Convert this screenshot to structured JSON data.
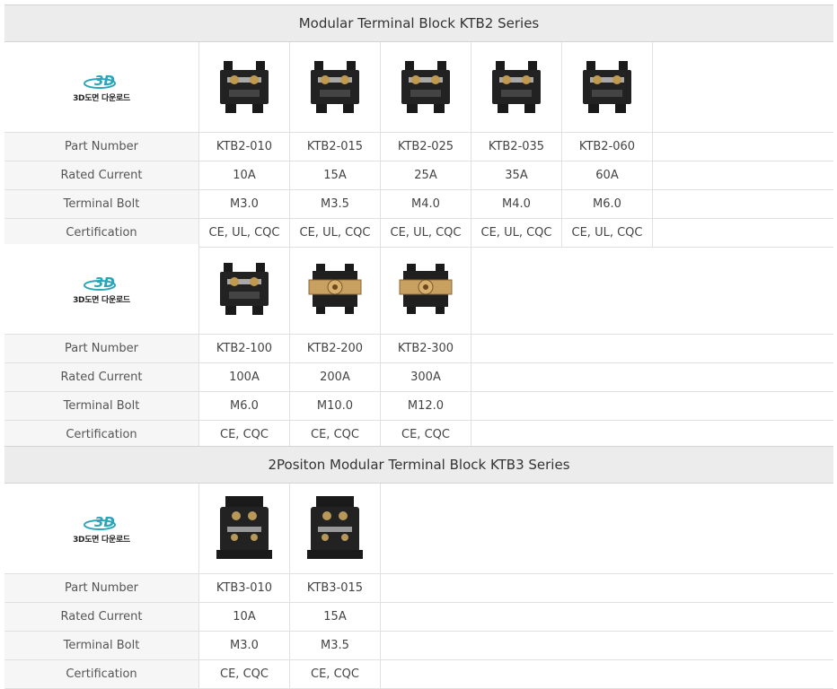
{
  "sections": [
    {
      "title": "Modular Terminal Block KTB2 Series",
      "groups": [
        {
          "logo_text": "3D도면 다운로드",
          "logo_mark": "3D",
          "products": [
            {
              "part": "KTB2-010",
              "current": "10A",
              "bolt": "M3.0",
              "cert": "CE, UL, CQC",
              "style": "dark"
            },
            {
              "part": "KTB2-015",
              "current": "15A",
              "bolt": "M3.5",
              "cert": "CE, UL, CQC",
              "style": "dark"
            },
            {
              "part": "KTB2-025",
              "current": "25A",
              "bolt": "M4.0",
              "cert": "CE, UL, CQC",
              "style": "dark"
            },
            {
              "part": "KTB2-035",
              "current": "35A",
              "bolt": "M4.0",
              "cert": "CE, UL, CQC",
              "style": "dark"
            },
            {
              "part": "KTB2-060",
              "current": "60A",
              "bolt": "M6.0",
              "cert": "CE, UL, CQC",
              "style": "dark"
            }
          ]
        },
        {
          "logo_text": "3D도면 다운로드",
          "logo_mark": "3D",
          "products": [
            {
              "part": "KTB2-100",
              "current": "100A",
              "bolt": "M6.0",
              "cert": "CE, CQC",
              "style": "dark"
            },
            {
              "part": "KTB2-200",
              "current": "200A",
              "bolt": "M10.0",
              "cert": "CE, CQC",
              "style": "brass"
            },
            {
              "part": "KTB2-300",
              "current": "300A",
              "bolt": "M12.0",
              "cert": "CE, CQC",
              "style": "brass"
            }
          ]
        }
      ]
    },
    {
      "title": "2Positon Modular Terminal Block KTB3 Series",
      "groups": [
        {
          "logo_text": "3D도면 다운로드",
          "logo_mark": "3D",
          "products": [
            {
              "part": "KTB3-010",
              "current": "10A",
              "bolt": "M3.0",
              "cert": "CE, CQC",
              "style": "tall"
            },
            {
              "part": "KTB3-015",
              "current": "15A",
              "bolt": "M3.5",
              "cert": "CE, CQC",
              "style": "tall"
            }
          ]
        }
      ]
    }
  ],
  "row_labels": {
    "part": "Part Number",
    "current": "Rated Current",
    "bolt": "Terminal Bolt",
    "cert": "Certification"
  },
  "colors": {
    "header_bg": "#ececec",
    "label_bg": "#f6f6f6",
    "border": "#e0e0e0",
    "logo_teal": "#2aa6b8"
  }
}
